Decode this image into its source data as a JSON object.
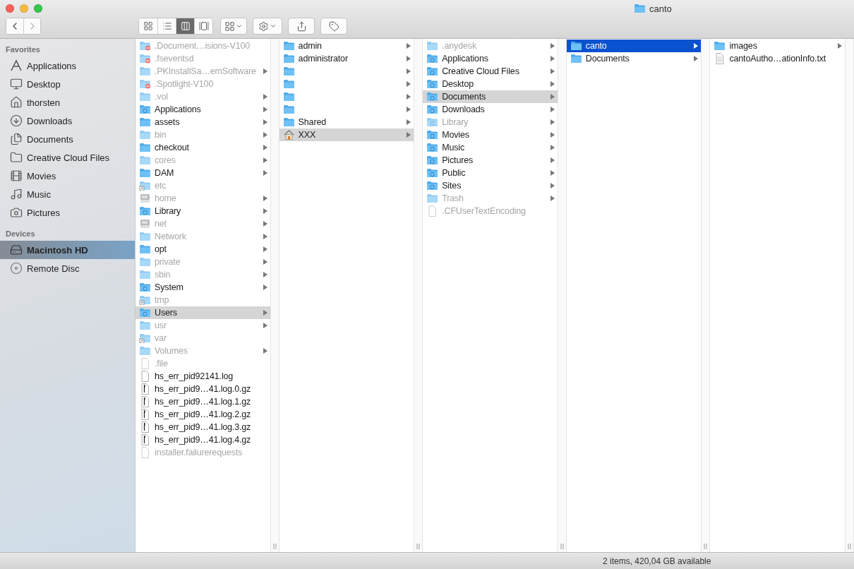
{
  "window": {
    "title": "canto"
  },
  "toolbar": {
    "nav": [
      {
        "kind": "back",
        "disabled": false
      },
      {
        "kind": "forward",
        "disabled": true
      }
    ],
    "view_modes": [
      {
        "kind": "icons",
        "selected": false
      },
      {
        "kind": "list",
        "selected": false
      },
      {
        "kind": "columns",
        "selected": true
      },
      {
        "kind": "cover-flow",
        "selected": false
      }
    ],
    "buttons": [
      {
        "kind": "arrange"
      },
      {
        "kind": "action"
      },
      {
        "kind": "share"
      },
      {
        "kind": "tag"
      }
    ]
  },
  "sidebar": {
    "sections": [
      {
        "title": "Favorites",
        "items": [
          {
            "name": "Applications",
            "kind": "applications",
            "selected": false
          },
          {
            "name": "Desktop",
            "kind": "desktop",
            "selected": false
          },
          {
            "name": "thorsten",
            "kind": "home",
            "selected": false
          },
          {
            "name": "Downloads",
            "kind": "downloads",
            "selected": false
          },
          {
            "name": "Documents",
            "kind": "documents",
            "selected": false
          },
          {
            "name": "Creative Cloud Files",
            "kind": "folder",
            "selected": false
          },
          {
            "name": "Movies",
            "kind": "movies",
            "selected": false
          },
          {
            "name": "Music",
            "kind": "music",
            "selected": false
          },
          {
            "name": "Pictures",
            "kind": "pictures",
            "selected": false
          }
        ]
      },
      {
        "title": "Devices",
        "items": [
          {
            "name": "Macintosh HD",
            "kind": "drive",
            "selected": true
          },
          {
            "name": "Remote Disc",
            "kind": "disc",
            "selected": false
          }
        ]
      }
    ]
  },
  "columns": [
    {
      "items": [
        {
          "name": ".Document…isions-V100",
          "kind": "restricted-folder",
          "dimmed": true,
          "has_children": false,
          "selected": false
        },
        {
          "name": ".fseventsd",
          "kind": "restricted-folder",
          "dimmed": true,
          "has_children": false,
          "selected": false
        },
        {
          "name": ".PKInstallSa…emSoftware",
          "kind": "folder",
          "dimmed": true,
          "has_children": true,
          "selected": false
        },
        {
          "name": ".Spotlight-V100",
          "kind": "restricted-folder",
          "dimmed": true,
          "has_children": false,
          "selected": false
        },
        {
          "name": ".vol",
          "kind": "folder",
          "dimmed": true,
          "has_children": true,
          "selected": false
        },
        {
          "name": "Applications",
          "kind": "special-folder",
          "dimmed": false,
          "has_children": true,
          "selected": false
        },
        {
          "name": "assets",
          "kind": "folder",
          "dimmed": false,
          "has_children": true,
          "selected": false
        },
        {
          "name": "bin",
          "kind": "folder",
          "dimmed": true,
          "has_children": true,
          "selected": false
        },
        {
          "name": "checkout",
          "kind": "folder",
          "dimmed": false,
          "has_children": true,
          "selected": false
        },
        {
          "name": "cores",
          "kind": "folder",
          "dimmed": true,
          "has_children": true,
          "selected": false
        },
        {
          "name": "DAM",
          "kind": "folder",
          "dimmed": false,
          "has_children": true,
          "selected": false
        },
        {
          "name": "etc",
          "kind": "alias-folder",
          "dimmed": true,
          "has_children": false,
          "selected": false
        },
        {
          "name": "home",
          "kind": "drive",
          "dimmed": true,
          "has_children": true,
          "selected": false
        },
        {
          "name": "Library",
          "kind": "special-folder",
          "dimmed": false,
          "has_children": true,
          "selected": false
        },
        {
          "name": "net",
          "kind": "drive",
          "dimmed": true,
          "has_children": true,
          "selected": false
        },
        {
          "name": "Network",
          "kind": "folder",
          "dimmed": true,
          "has_children": true,
          "selected": false
        },
        {
          "name": "opt",
          "kind": "folder",
          "dimmed": false,
          "has_children": true,
          "selected": false
        },
        {
          "name": "private",
          "kind": "folder",
          "dimmed": true,
          "has_children": true,
          "selected": false
        },
        {
          "name": "sbin",
          "kind": "folder",
          "dimmed": true,
          "has_children": true,
          "selected": false
        },
        {
          "name": "System",
          "kind": "special-folder",
          "dimmed": false,
          "has_children": true,
          "selected": false
        },
        {
          "name": "tmp",
          "kind": "alias-folder",
          "dimmed": true,
          "has_children": false,
          "selected": false
        },
        {
          "name": "Users",
          "kind": "special-folder",
          "dimmed": false,
          "has_children": true,
          "selected": true,
          "focused": false
        },
        {
          "name": "usr",
          "kind": "folder",
          "dimmed": true,
          "has_children": true,
          "selected": false
        },
        {
          "name": "var",
          "kind": "alias-folder",
          "dimmed": true,
          "has_children": false,
          "selected": false
        },
        {
          "name": "Volumes",
          "kind": "folder",
          "dimmed": true,
          "has_children": true,
          "selected": false
        },
        {
          "name": ".file",
          "kind": "file",
          "dimmed": true,
          "has_children": false,
          "selected": false
        },
        {
          "name": "hs_err_pid92141.log",
          "kind": "file",
          "dimmed": false,
          "has_children": false,
          "selected": false
        },
        {
          "name": "hs_err_pid9…41.log.0.gz",
          "kind": "archive",
          "dimmed": false,
          "has_children": false,
          "selected": false
        },
        {
          "name": "hs_err_pid9…41.log.1.gz",
          "kind": "archive",
          "dimmed": false,
          "has_children": false,
          "selected": false
        },
        {
          "name": "hs_err_pid9…41.log.2.gz",
          "kind": "archive",
          "dimmed": false,
          "has_children": false,
          "selected": false
        },
        {
          "name": "hs_err_pid9…41.log.3.gz",
          "kind": "archive",
          "dimmed": false,
          "has_children": false,
          "selected": false
        },
        {
          "name": "hs_err_pid9…41.log.4.gz",
          "kind": "archive",
          "dimmed": false,
          "has_children": false,
          "selected": false
        },
        {
          "name": "installer.failurerequests",
          "kind": "file",
          "dimmed": true,
          "has_children": false,
          "selected": false
        }
      ]
    },
    {
      "items": [
        {
          "name": "admin",
          "kind": "folder",
          "dimmed": false,
          "has_children": true,
          "selected": false
        },
        {
          "name": "administrator",
          "kind": "folder",
          "dimmed": false,
          "has_children": true,
          "selected": false
        },
        {
          "kind": "folder",
          "dimmed": false,
          "has_children": true,
          "selected": false
        },
        {
          "kind": "folder",
          "dimmed": false,
          "has_children": true,
          "selected": false
        },
        {
          "kind": "folder",
          "dimmed": false,
          "has_children": true,
          "selected": false
        },
        {
          "kind": "folder",
          "dimmed": false,
          "has_children": true,
          "selected": false
        },
        {
          "name": "Shared",
          "kind": "folder",
          "dimmed": false,
          "has_children": true,
          "selected": false
        },
        {
          "name": "XXX",
          "kind": "home",
          "dimmed": false,
          "has_children": true,
          "selected": true,
          "focused": false
        }
      ]
    },
    {
      "items": [
        {
          "name": ".anydesk",
          "kind": "folder",
          "dimmed": true,
          "has_children": true,
          "selected": false
        },
        {
          "name": "Applications",
          "kind": "special-folder",
          "dimmed": false,
          "has_children": true,
          "selected": false
        },
        {
          "name": "Creative Cloud Files",
          "kind": "special-folder",
          "dimmed": false,
          "has_children": true,
          "selected": false
        },
        {
          "name": "Desktop",
          "kind": "special-folder",
          "dimmed": false,
          "has_children": true,
          "selected": false
        },
        {
          "name": "Documents",
          "kind": "special-folder",
          "dimmed": false,
          "has_children": true,
          "selected": true,
          "focused": false
        },
        {
          "name": "Downloads",
          "kind": "special-folder",
          "dimmed": false,
          "has_children": true,
          "selected": false
        },
        {
          "name": "Library",
          "kind": "special-folder",
          "dimmed": true,
          "has_children": true,
          "selected": false
        },
        {
          "name": "Movies",
          "kind": "special-folder",
          "dimmed": false,
          "has_children": true,
          "selected": false
        },
        {
          "name": "Music",
          "kind": "special-folder",
          "dimmed": false,
          "has_children": true,
          "selected": false
        },
        {
          "name": "Pictures",
          "kind": "special-folder",
          "dimmed": false,
          "has_children": true,
          "selected": false
        },
        {
          "name": "Public",
          "kind": "special-folder",
          "dimmed": false,
          "has_children": true,
          "selected": false
        },
        {
          "name": "Sites",
          "kind": "special-folder",
          "dimmed": false,
          "has_children": true,
          "selected": false
        },
        {
          "name": "Trash",
          "kind": "folder",
          "dimmed": true,
          "has_children": true,
          "selected": false
        },
        {
          "name": ".CFUserTextEncoding",
          "kind": "file",
          "dimmed": true,
          "has_children": false,
          "selected": false
        }
      ]
    },
    {
      "items": [
        {
          "name": "canto",
          "kind": "folder",
          "dimmed": false,
          "has_children": true,
          "selected": true,
          "focused": true
        },
        {
          "name": "Documents",
          "kind": "folder",
          "dimmed": false,
          "has_children": true,
          "selected": false
        }
      ]
    },
    {
      "items": [
        {
          "name": "images",
          "kind": "folder",
          "dimmed": false,
          "has_children": true,
          "selected": false
        },
        {
          "name": "cantoAutho…ationInfo.txt",
          "kind": "text-file",
          "dimmed": false,
          "has_children": false,
          "selected": false
        }
      ]
    }
  ],
  "status_bar": {
    "text": "2 items, 420,04 GB available"
  }
}
